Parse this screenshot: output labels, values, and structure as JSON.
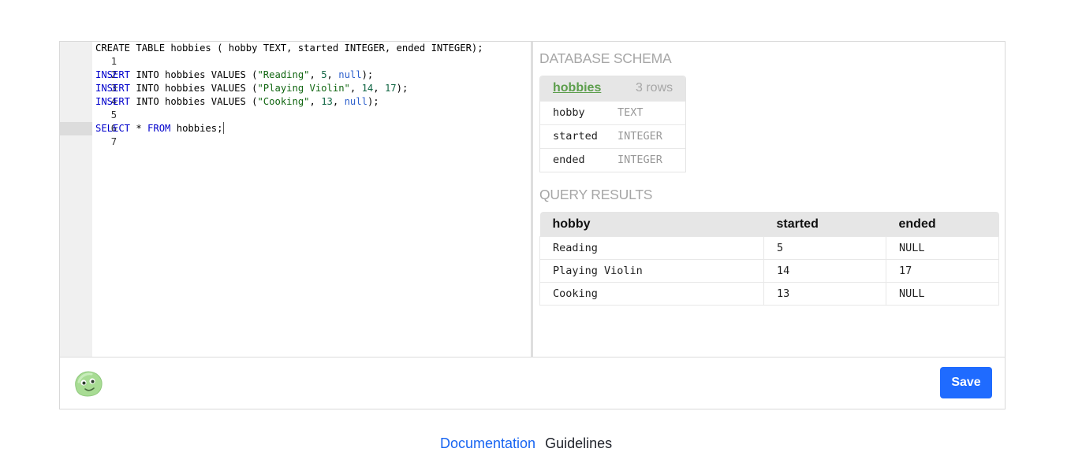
{
  "editor": {
    "lines": [
      {
        "n": "1"
      },
      {
        "n": "2"
      },
      {
        "n": "3"
      },
      {
        "n": "4"
      },
      {
        "n": "5"
      },
      {
        "n": "6"
      },
      {
        "n": "7"
      }
    ],
    "line1": "CREATE TABLE hobbies ( hobby TEXT, started INTEGER, ended INTEGER);",
    "insert_kw": "INSERT",
    "into_values": " INTO hobbies VALUES (",
    "row1_str": "\"Reading\"",
    "row1_a": "5",
    "row1_b": "null",
    "row2_str": "\"Playing Violin\"",
    "row2_a": "14",
    "row2_b": "17",
    "row3_str": "\"Cooking\"",
    "row3_a": "13",
    "row3_b": "null",
    "select_kw": "SELECT",
    "star": " * ",
    "from_kw": "FROM",
    "select_rest": " hobbies;"
  },
  "schema": {
    "title": "DATABASE SCHEMA",
    "table_name": "hobbies",
    "row_count": "3 rows",
    "columns": [
      {
        "name": "hobby",
        "type": "TEXT"
      },
      {
        "name": "started",
        "type": "INTEGER"
      },
      {
        "name": "ended",
        "type": "INTEGER"
      }
    ]
  },
  "results": {
    "title": "QUERY RESULTS",
    "headers": [
      "hobby",
      "started",
      "ended"
    ],
    "rows": [
      [
        "Reading",
        "5",
        "NULL"
      ],
      [
        "Playing Violin",
        "14",
        "17"
      ],
      [
        "Cooking",
        "13",
        "NULL"
      ]
    ]
  },
  "footer": {
    "save_label": "Save"
  },
  "bottom": {
    "link1": "Documentation",
    "link2": "Guidelines"
  },
  "colors": {
    "accent": "#1f6bff",
    "schema_link": "#5c9e4c",
    "keyword": "#0000cc",
    "string": "#116611"
  }
}
